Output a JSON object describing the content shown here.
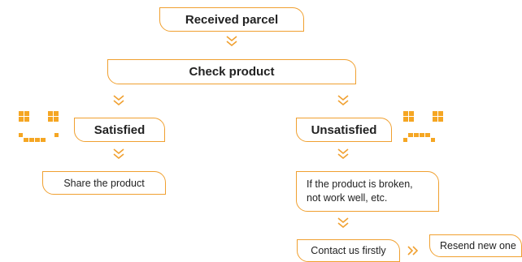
{
  "nodes": {
    "received_parcel": "Received parcel",
    "check_product": "Check product",
    "satisfied": "Satisfied",
    "unsatisfied": "Unsatisfied",
    "share_product": "Share the product",
    "broken_line1": "If the product is broken,",
    "broken_line2": "not work well, etc.",
    "contact_us": "Contact us firstly",
    "resend": "Resend new one"
  },
  "icons": {
    "down_arrow": "double-chevron-down-icon",
    "right_arrow": "double-chevron-right-icon",
    "happy_face": "pixel-smile-icon",
    "sad_face": "pixel-frown-icon"
  },
  "colors": {
    "accent": "#f0a030",
    "pixel": "#f5a623",
    "text": "#222222"
  }
}
